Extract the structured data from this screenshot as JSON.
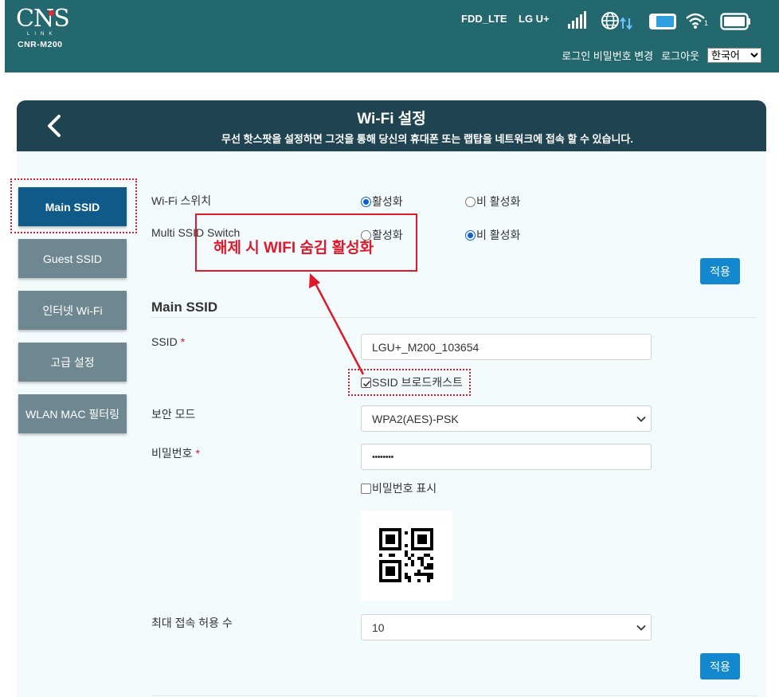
{
  "header": {
    "logo": {
      "wordmark": "CNS",
      "link_text": "LINK",
      "model": "CNR-M200"
    },
    "network_type": "FDD_LTE",
    "carrier": "LG U+",
    "icons": [
      "signal-bars-icon",
      "globe-data-icon",
      "battery-status-icon",
      "wifi-icon",
      "battery-icon"
    ],
    "wifi_clients": "1",
    "links": {
      "change_password": "로그인 비밀번호 변경",
      "logout": "로그아웃"
    },
    "language": "한국어"
  },
  "page": {
    "title": "Wi-Fi 설정",
    "description": "무선 핫스팟을 설정하면 그것을 통해 당신의 휴대폰 또는 랩탑을 네트워크에 접속 할 수 있습니다."
  },
  "sidebar": {
    "items": [
      {
        "label": "Main SSID",
        "active": true
      },
      {
        "label": "Guest SSID",
        "active": false
      },
      {
        "label": "인터넷 Wi-Fi",
        "active": false
      },
      {
        "label": "고급 설정",
        "active": false
      },
      {
        "label": "WLAN MAC 필터링",
        "active": false
      }
    ]
  },
  "switches": {
    "wifi_switch": {
      "label": "Wi-Fi 스위치",
      "on_label": "활성화",
      "off_label": "비 활성화",
      "value": "on"
    },
    "multi_ssid": {
      "label": "Multi SSID Switch",
      "on_label": "활성화",
      "off_label": "비 활성화",
      "value": "off"
    },
    "apply_label": "적용"
  },
  "main_ssid": {
    "section_title": "Main SSID",
    "ssid": {
      "label": "SSID",
      "required_mark": "*",
      "value": "LGU+_M200_103654"
    },
    "broadcast": {
      "label": "SSID 브로드캐스트",
      "checked": true
    },
    "security": {
      "label": "보안 모드",
      "value": "WPA2(AES)-PSK"
    },
    "password": {
      "label": "비밀번호",
      "required_mark": "*",
      "value": "••••••••"
    },
    "show_password": {
      "label": "비밀번호 표시",
      "checked": false
    },
    "max_clients": {
      "label": "최대 접속 허용 수",
      "value": "10"
    },
    "apply_label": "적용"
  },
  "annotation": {
    "text": "해제 시 WIFI 숨김 활성화",
    "color": "#e0182a"
  },
  "colors": {
    "header_bg": "#23686e",
    "panel_head_bg": "#1f4350",
    "panel_bg": "#f4fbfd",
    "active_tab": "#0f5a88",
    "inactive_tab": "#6f8790",
    "apply_button": "#1488cf",
    "highlight": "#e0182a"
  }
}
